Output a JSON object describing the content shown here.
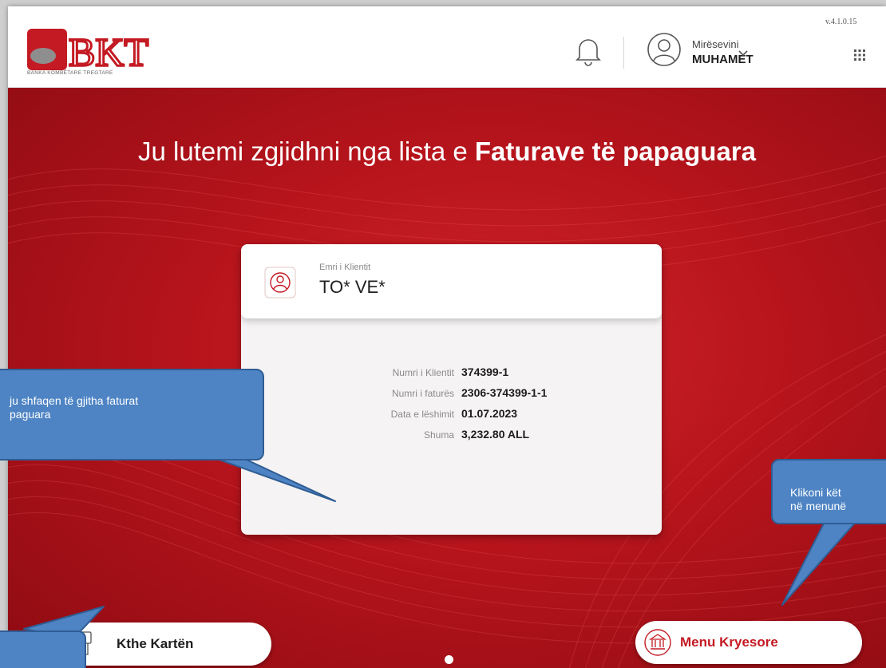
{
  "header": {
    "logo_text": "BKT",
    "logo_subtitle": "BANKA KOMBËTARE TREGTARE",
    "greeting": "Mirësevini",
    "username": "MUHAMET",
    "version": "v.4.1.0.15"
  },
  "title": {
    "part1": "Ju lutemi zgjidhni nga lista e ",
    "part2": "Faturave të papaguara"
  },
  "card": {
    "client_label": "Emri i Klientit",
    "client_name": "TO* VE*",
    "rows": [
      {
        "label": "Numri i Klientit",
        "value": "374399-1"
      },
      {
        "label": "Numri i faturës",
        "value": "2306-374399-1-1"
      },
      {
        "label": "Data e lëshimit",
        "value": "01.07.2023"
      },
      {
        "label": "Shuma",
        "value": "3,232.80 ALL"
      }
    ]
  },
  "buttons": {
    "return_card": "Kthe Kartën",
    "main_menu": "Menu Kryesore"
  },
  "callouts": {
    "left_line1": "ju shfaqen të gjitha faturat",
    "left_line2": "paguara",
    "right_line1": "Klikoni kët",
    "right_line2": "në menunë"
  },
  "icons": {
    "bell": "bell-icon",
    "user": "user-circle-icon",
    "chevron": "chevron-down-icon",
    "apps": "apps-grid-icon",
    "client": "client-icon",
    "card_return": "card-return-icon",
    "bank": "bank-icon"
  },
  "colors": {
    "brand_red": "#c41a23",
    "background_red": "#b5121b",
    "callout_blue": "#4e84c4"
  }
}
